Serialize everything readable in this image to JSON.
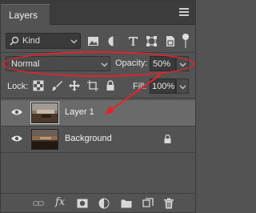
{
  "panel": {
    "tab_label": "Layers",
    "menu_icon": "hamburger-menu-icon"
  },
  "filter": {
    "kind_label": "Kind",
    "icons": [
      "pixel-layer-filter-icon",
      "adjustment-layer-filter-icon",
      "type-layer-filter-icon",
      "shape-layer-filter-icon",
      "smart-object-filter-icon",
      "filter-toggle-icon"
    ]
  },
  "blend": {
    "mode": "Normal",
    "opacity_label": "Opacity:",
    "opacity_value": "50%"
  },
  "lock": {
    "label": "Lock:",
    "icons": [
      "lock-transparent-pixels-icon",
      "lock-image-pixels-icon",
      "lock-position-icon",
      "lock-artboard-icon",
      "lock-all-icon"
    ],
    "fill_label": "Fill:",
    "fill_value": "100%"
  },
  "layers": [
    {
      "name": "Layer 1",
      "selected": true,
      "visible": true,
      "locked": false
    },
    {
      "name": "Background",
      "selected": false,
      "visible": true,
      "locked": true
    }
  ],
  "bottom_toolbar": {
    "icons": [
      "link-layers-icon",
      "layer-style-fx-icon",
      "add-mask-icon",
      "new-adjustment-layer-icon",
      "new-group-icon",
      "new-layer-icon",
      "delete-layer-icon"
    ],
    "fx_label": "fx"
  },
  "annotation": {
    "color": "#e0242b"
  }
}
